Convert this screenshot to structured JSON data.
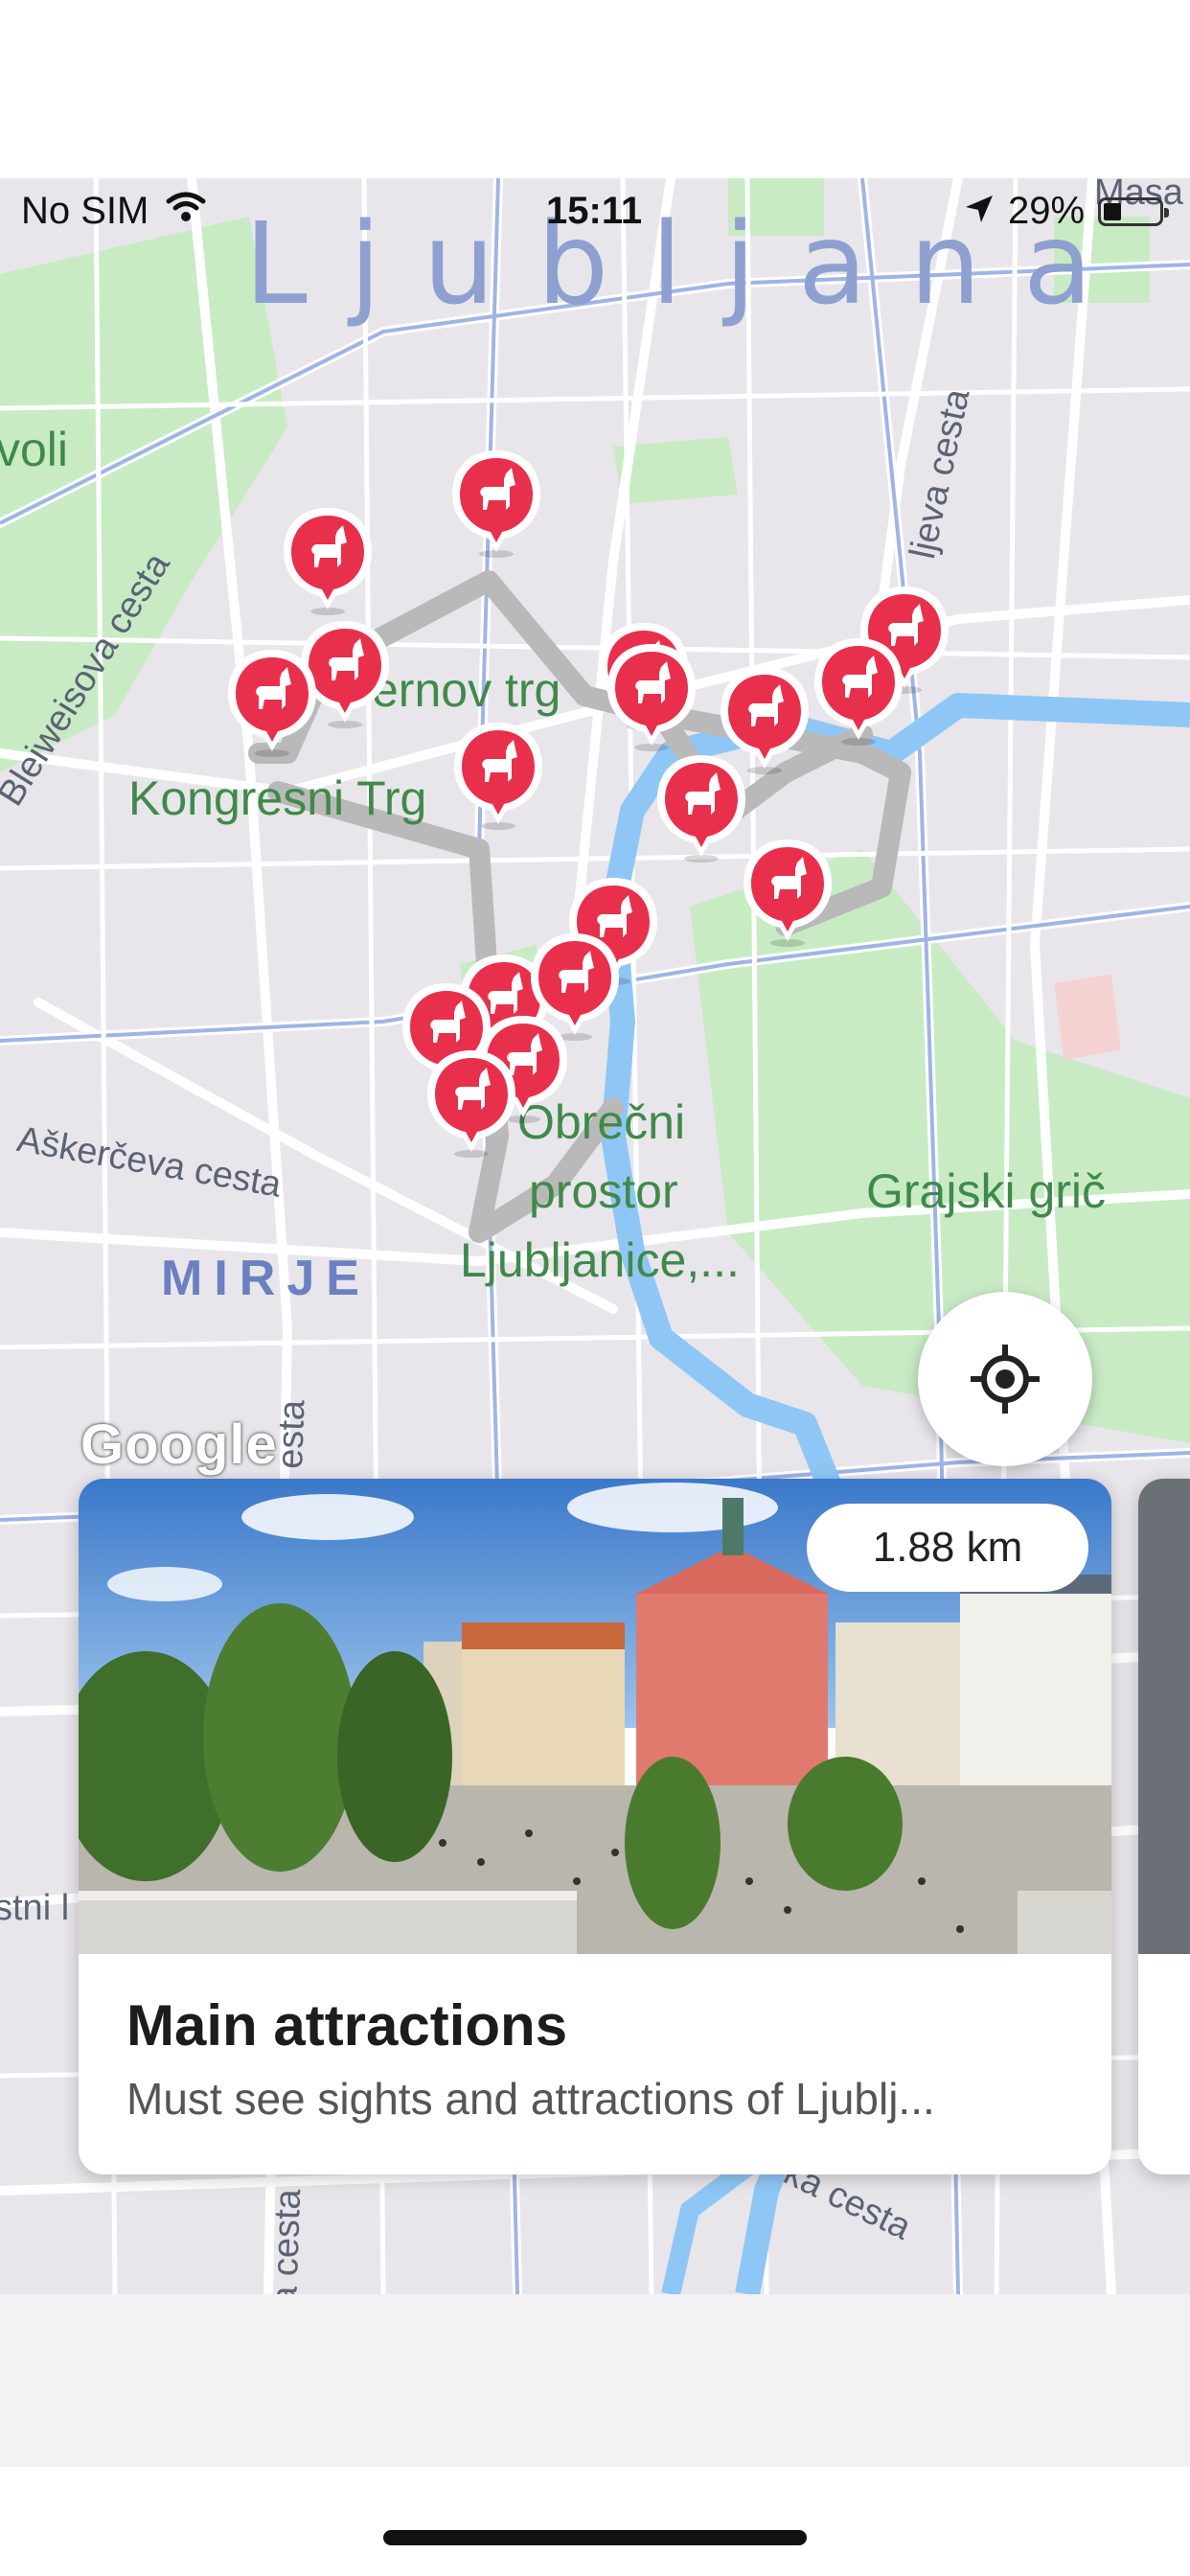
{
  "status_bar": {
    "carrier": "No SIM",
    "time": "15:11",
    "battery_percent": "29%",
    "battery_level": 0.29,
    "icons": [
      "wifi-icon",
      "location-arrow-icon",
      "battery-icon"
    ]
  },
  "map": {
    "city_label": "Ljubljana",
    "labels": {
      "tivoli": "voli",
      "presernov": "ernov trg",
      "kongresni": "Kongresni Trg",
      "obrecni_1": "Obrečni",
      "obrecni_2": "prostor",
      "obrecni_3": "Ljubljanice,...",
      "grajski": "Grajski grič",
      "district": "MIRJE",
      "askerceva": "Aškerčeva cesta",
      "bleiweisova": "Bleiweisova cesta",
      "resljeva": "ljeva cesta",
      "masa": "Masa",
      "cesta_1": "esta",
      "cesta_2": "a cesta",
      "cesta_3": "ka cesta",
      "stni": "stni l"
    },
    "pin_icon": "llama-pin-icon",
    "pin_count": 20,
    "google_logo": "Google",
    "colors": {
      "pin": "#e8304c",
      "river": "#8ec7f5",
      "park": "#c8ebc4",
      "route": "#b9b9b9"
    }
  },
  "locate_button": {
    "icon": "crosshair-icon"
  },
  "card": {
    "distance": "1.88 km",
    "title": "Main attractions",
    "subtitle": "Must see sights and attractions of Ljublj..."
  }
}
